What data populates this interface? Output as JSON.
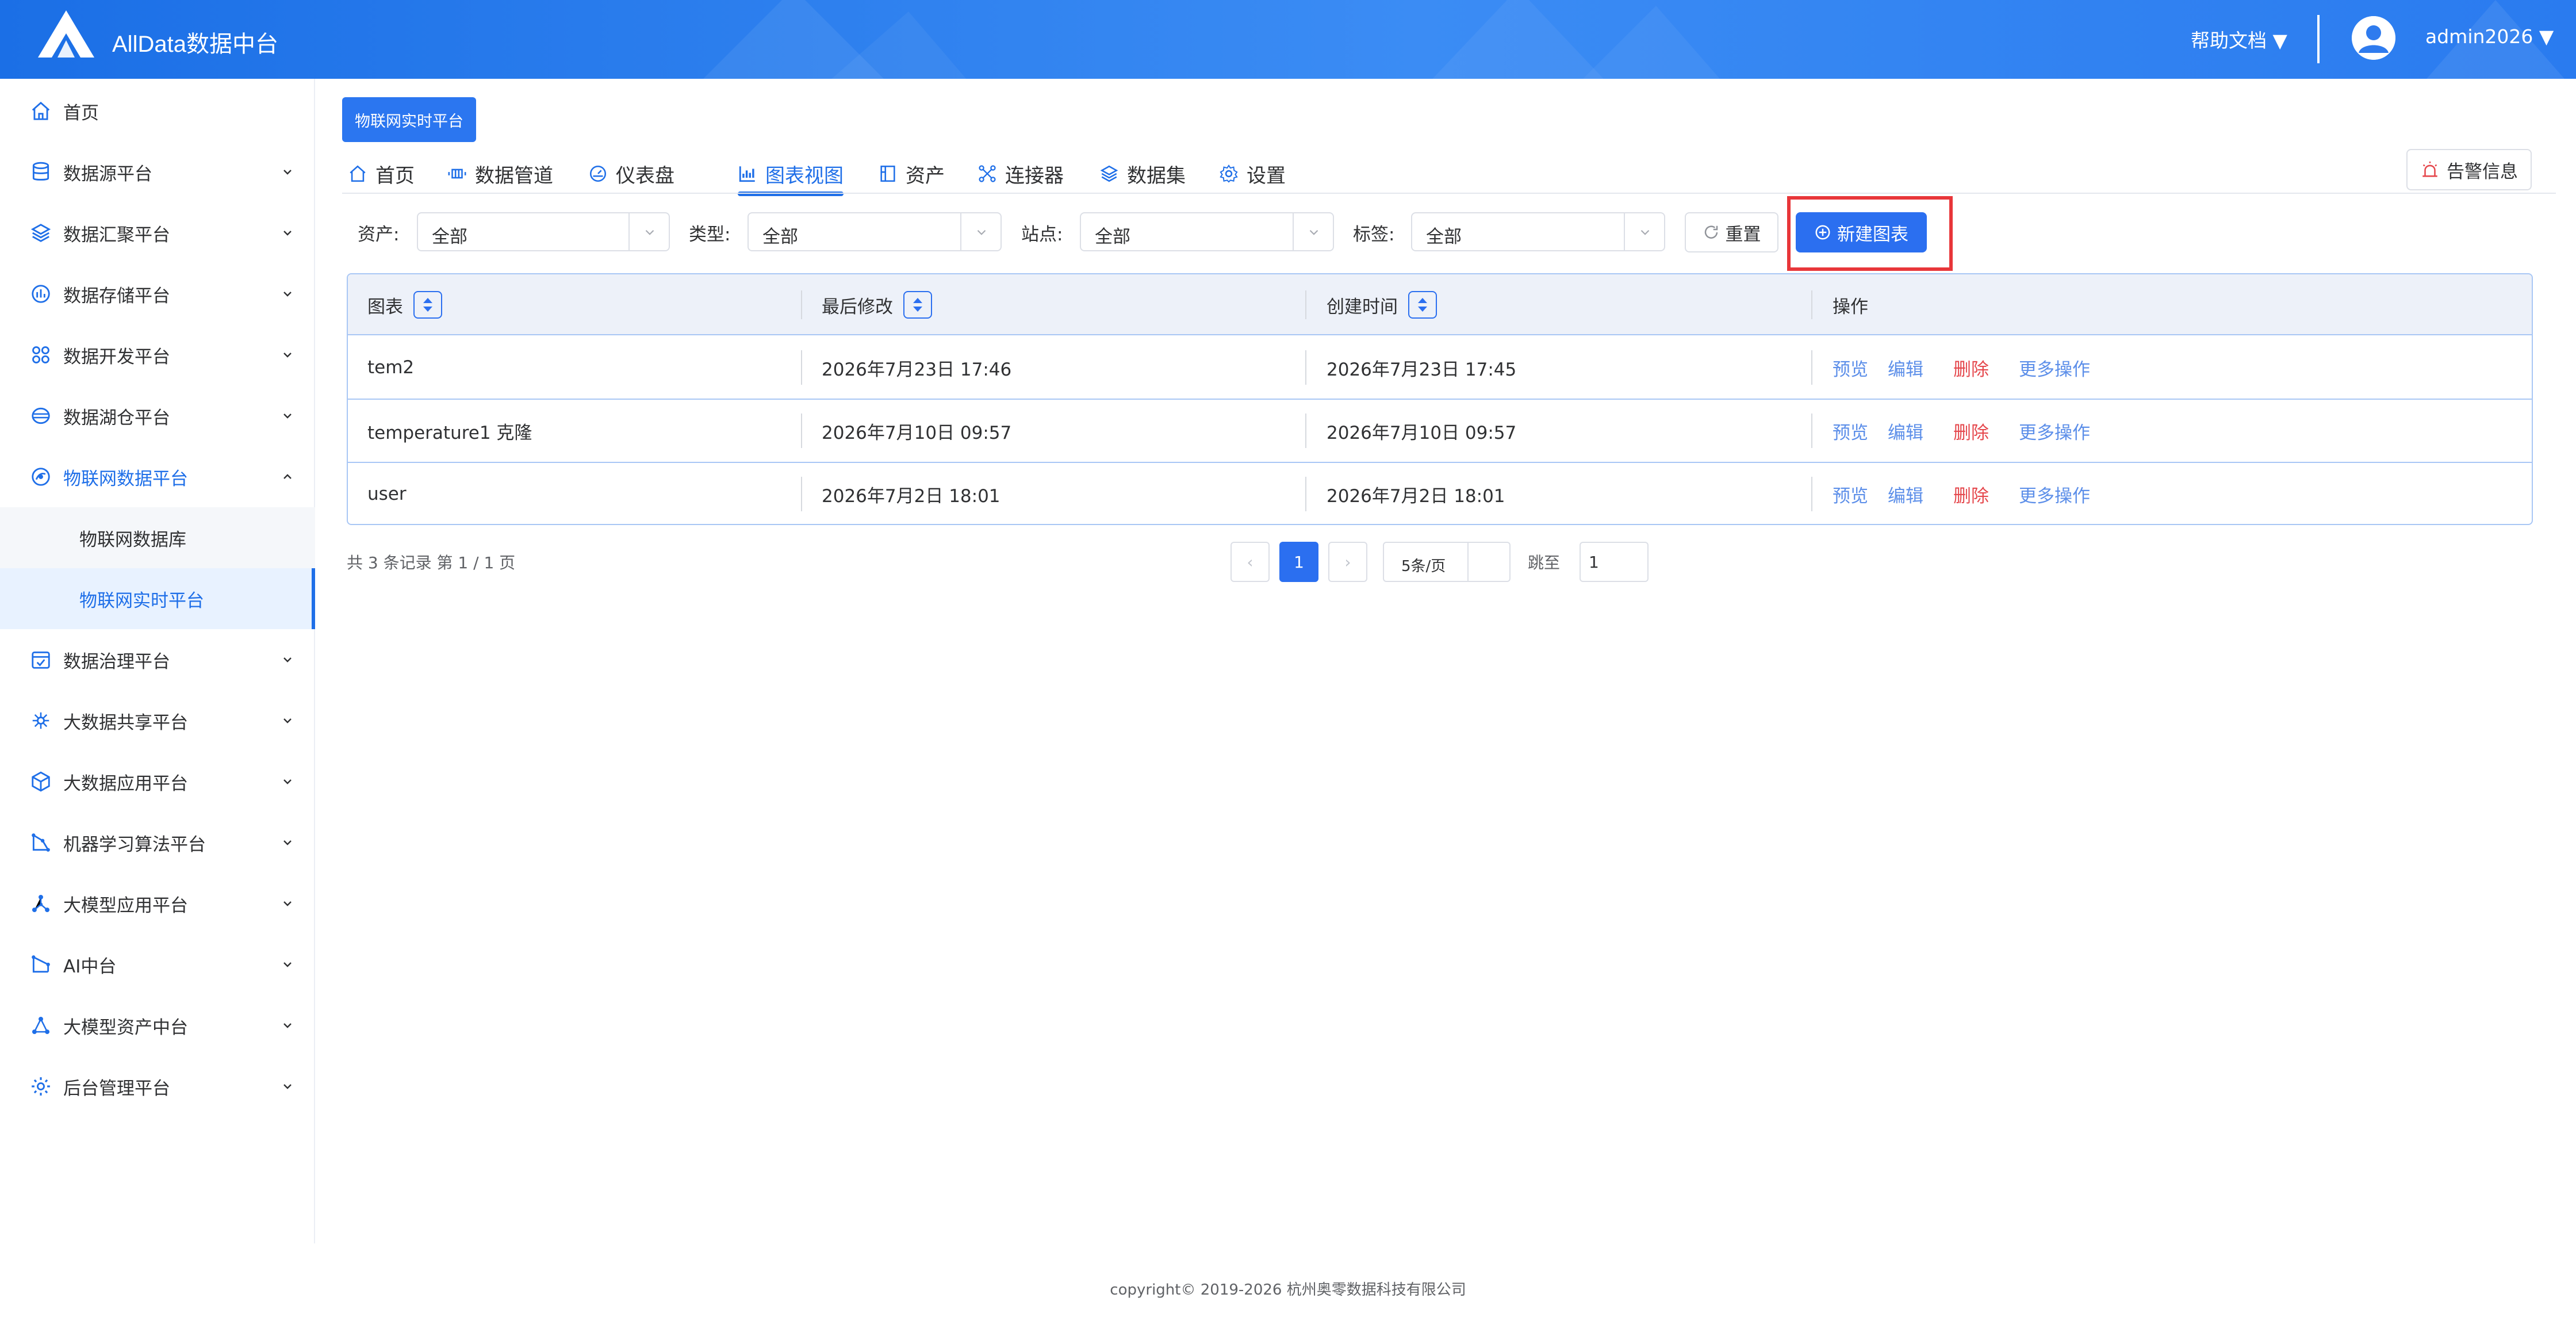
{
  "header": {
    "brand": "AllData数据中台",
    "help": "帮助文档 ▼",
    "user": "admin2026 ▼"
  },
  "sidebar": {
    "items": [
      {
        "label": "首页",
        "icon": "home-icon"
      },
      {
        "label": "数据源平台",
        "icon": "database-icon"
      },
      {
        "label": "数据汇聚平台",
        "icon": "layers-icon"
      },
      {
        "label": "数据存储平台",
        "icon": "storage-icon"
      },
      {
        "label": "数据开发平台",
        "icon": "grid-icon"
      },
      {
        "label": "数据湖仓平台",
        "icon": "lake-icon"
      },
      {
        "label": "物联网数据平台",
        "icon": "iot-icon"
      },
      {
        "label": "数据治理平台",
        "icon": "governance-icon"
      },
      {
        "label": "大数据共享平台",
        "icon": "share-icon"
      },
      {
        "label": "大数据应用平台",
        "icon": "cube-icon"
      },
      {
        "label": "机器学习算法平台",
        "icon": "ml-icon"
      },
      {
        "label": "大模型应用平台",
        "icon": "model-app-icon"
      },
      {
        "label": "AI中台",
        "icon": "ai-icon"
      },
      {
        "label": "大模型资产中台",
        "icon": "model-asset-icon"
      },
      {
        "label": "后台管理平台",
        "icon": "admin-gear-icon"
      }
    ],
    "subitems": [
      {
        "label": "物联网数据库"
      },
      {
        "label": "物联网实时平台"
      }
    ]
  },
  "breadcrumb": "物联网实时平台",
  "tabs": [
    {
      "label": "首页",
      "icon": "home-icon"
    },
    {
      "label": "数据管道",
      "icon": "pipeline-icon"
    },
    {
      "label": "仪表盘",
      "icon": "dashboard-icon"
    },
    {
      "label": "图表视图",
      "icon": "chart-icon"
    },
    {
      "label": "资产",
      "icon": "asset-icon"
    },
    {
      "label": "连接器",
      "icon": "connector-icon"
    },
    {
      "label": "数据集",
      "icon": "dataset-icon"
    },
    {
      "label": "设置",
      "icon": "settings-icon"
    }
  ],
  "alert_button": "告警信息",
  "filters": [
    {
      "label": "资产:",
      "value": "全部"
    },
    {
      "label": "类型:",
      "value": "全部"
    },
    {
      "label": "站点:",
      "value": "全部"
    },
    {
      "label": "标签:",
      "value": "全部"
    }
  ],
  "reset_button": "重置",
  "new_button": "新建图表",
  "table": {
    "columns": [
      "图表",
      "最后修改",
      "创建时间",
      "操作"
    ],
    "rows": [
      {
        "name": "tem2",
        "modified": "2026年7月23日 17:46",
        "created": "2026年7月23日 17:45"
      },
      {
        "name": "temperature1 克隆",
        "modified": "2026年7月10日 09:57",
        "created": "2026年7月10日 09:57"
      },
      {
        "name": "user",
        "modified": "2026年7月2日 18:01",
        "created": "2026年7月2日 18:01"
      }
    ],
    "actions": [
      "预览",
      "编辑",
      "删除",
      "更多操作"
    ]
  },
  "pagination": {
    "total": "共 3 条记录 第 1 / 1 页",
    "prev": "‹",
    "current": "1",
    "next": "›",
    "page_size": "5条/页",
    "goto_label": "跳至",
    "goto_value": "1"
  },
  "footer": "copyright© 2019-2026 杭州奥零数据科技有限公司",
  "colors": {
    "primary": "#2b6ff0",
    "danger": "#e5484d",
    "highlight": "#e8363a"
  }
}
